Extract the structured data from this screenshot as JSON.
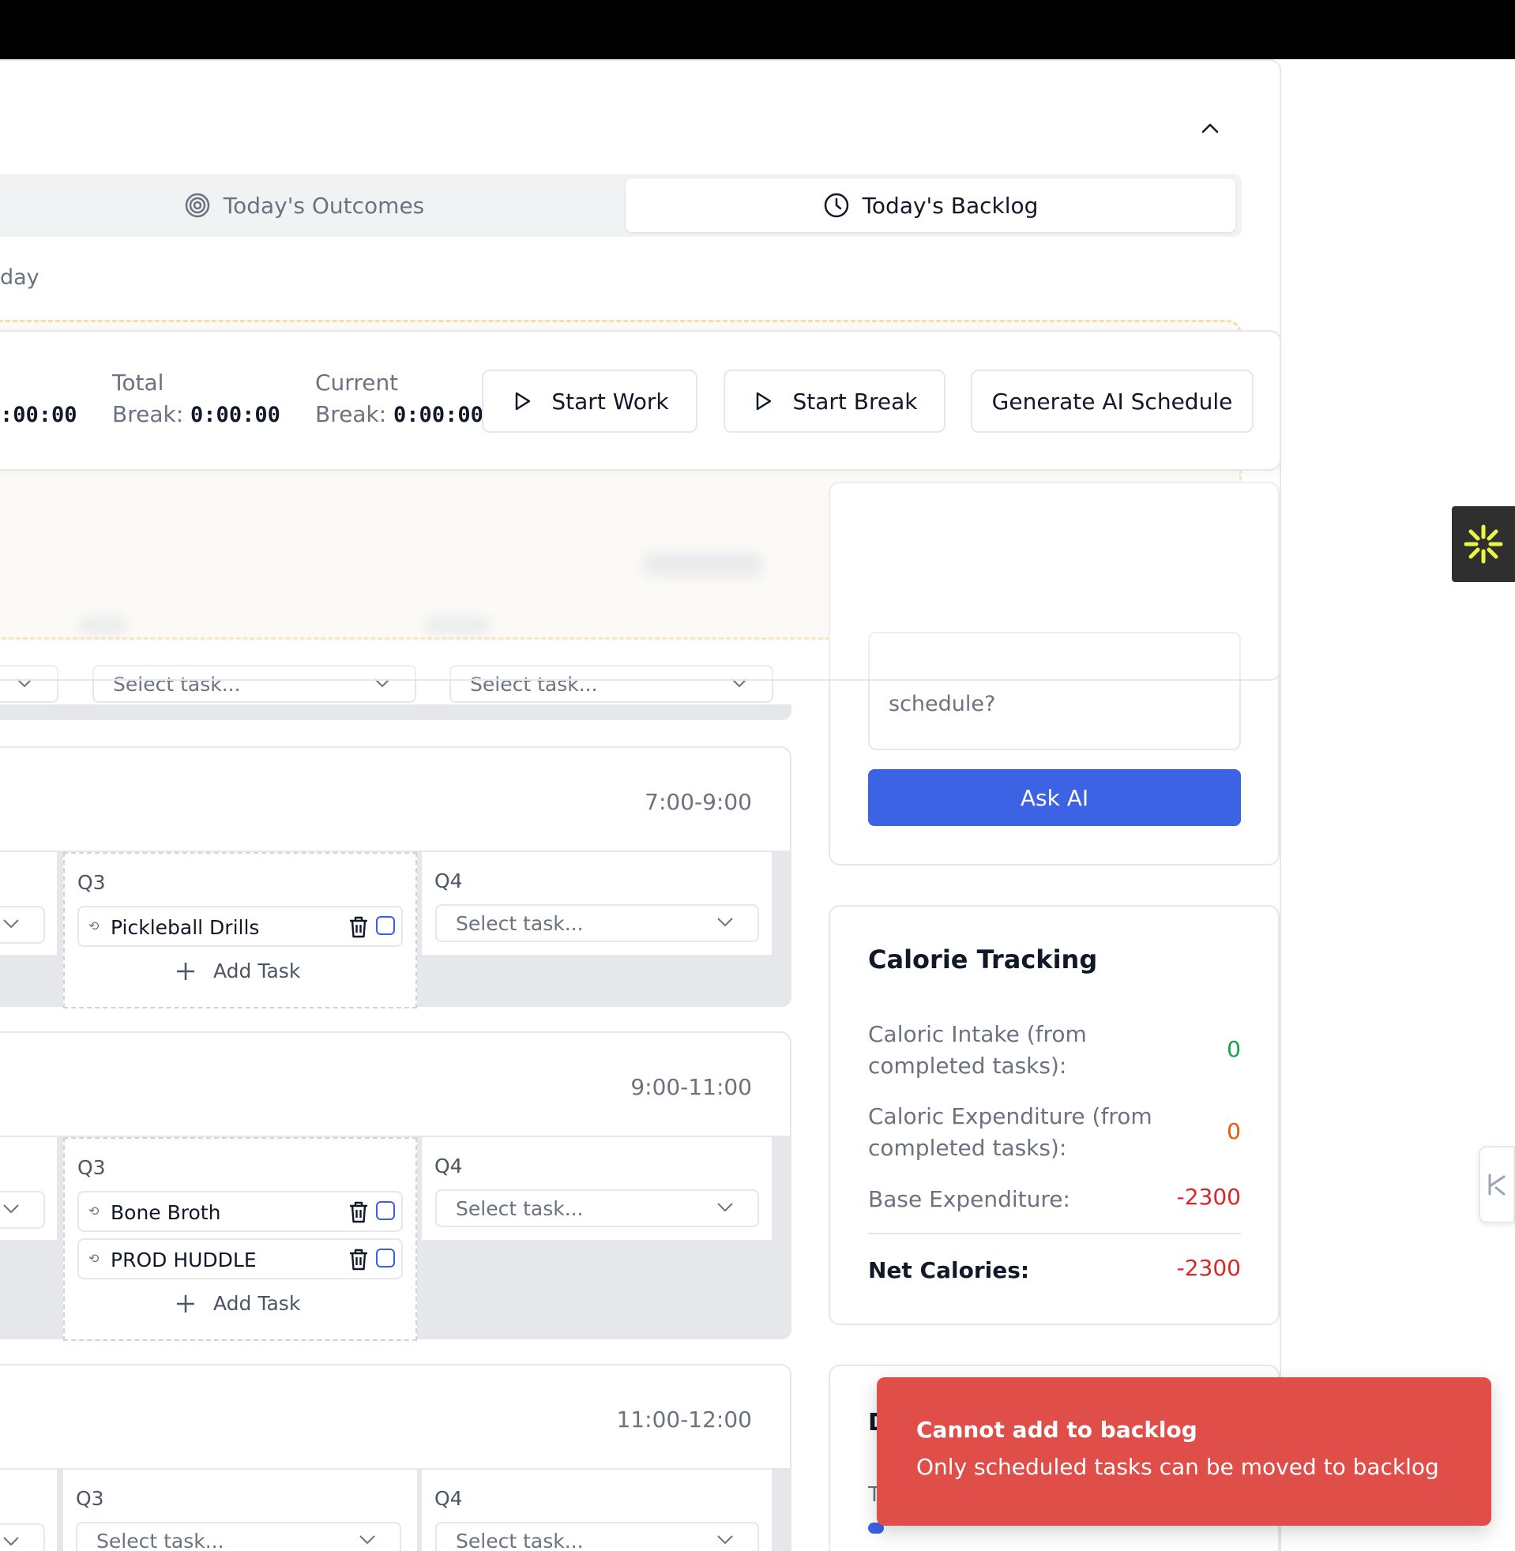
{
  "tabs": [
    {
      "label": "Today's Outcomes",
      "icon": "target-icon"
    },
    {
      "label": "Today's Backlog",
      "icon": "clock-icon",
      "active": true
    }
  ],
  "backlog_heading_fragment": "day",
  "timer": {
    "work_value_fragment": ":00:00",
    "total_break_label_line1": "Total",
    "total_break_label_line2": "Break:",
    "total_break_value": "0:00:00",
    "current_break_label_line1": "Current",
    "current_break_label_line2": "Break:",
    "current_break_value": "0:00:00",
    "start_work": "Start Work",
    "start_break": "Start Break",
    "generate_ai": "Generate AI Schedule"
  },
  "select_placeholder": "Select task...",
  "add_task_label": "Add Task",
  "blocks": [
    {
      "time": "7:00-9:00",
      "q3_label": "Q3",
      "q4_label": "Q4",
      "q3_tasks": [
        "Pickleball Drills"
      ]
    },
    {
      "time": "9:00-11:00",
      "q3_label": "Q3",
      "q4_label": "Q4",
      "q3_tasks": [
        "Bone Broth",
        "PROD HUDDLE"
      ]
    },
    {
      "time": "11:00-12:00",
      "q3_label": "Q3",
      "q4_label": "Q4",
      "q3_tasks": []
    }
  ],
  "ai": {
    "input_placeholder_tail": "schedule?",
    "ask_button": "Ask AI"
  },
  "calorie": {
    "title": "Calorie Tracking",
    "intake_label": "Caloric Intake (from completed tasks):",
    "intake_value": "0",
    "expenditure_label": "Caloric Expenditure (from completed tasks):",
    "expenditure_value": "0",
    "base_label": "Base Expenditure:",
    "base_value": "-2300",
    "net_label": "Net Calories:",
    "net_value": "-2300",
    "colors": {
      "intake": "#16a34a",
      "expenditure": "#ea580c",
      "negative": "#dc2626"
    }
  },
  "next_card_peek": {
    "heading_initial": "D",
    "text_initial": "T"
  },
  "toast": {
    "title": "Cannot add to backlog",
    "description": "Only scheduled tasks can be moved to backlog"
  }
}
